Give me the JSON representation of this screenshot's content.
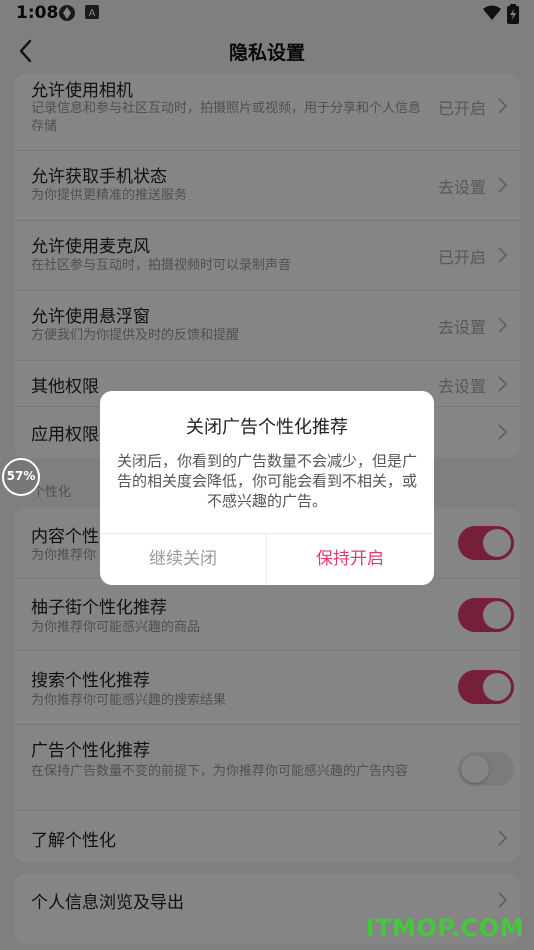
{
  "status": {
    "time": "1:08"
  },
  "header": {
    "title": "隐私设置"
  },
  "permissions": [
    {
      "title": "允许使用相机",
      "subtitle": "记录信息和参与社区互动时，拍摄照片或视频，用于分享和个人信息存储",
      "value": "已开启"
    },
    {
      "title": "允许获取手机状态",
      "subtitle": "为你提供更精准的推送服务",
      "value": "去设置"
    },
    {
      "title": "允许使用麦克风",
      "subtitle": "在社区参与互动时，拍摄视频时可以录制声音",
      "value": "已开启"
    },
    {
      "title": "允许使用悬浮窗",
      "subtitle": "方便我们为你提供及时的反馈和提醒",
      "value": "去设置"
    },
    {
      "title": "其他权限",
      "subtitle": "",
      "value": "去设置"
    },
    {
      "title": "应用权限",
      "subtitle": "",
      "value": ""
    }
  ],
  "section_title": "个性化",
  "personalization": [
    {
      "title": "内容个性",
      "subtitle": "为你推荐你",
      "on": true
    },
    {
      "title": "柚子街个性化推荐",
      "subtitle": "为你推荐你可能感兴趣的商品",
      "on": true
    },
    {
      "title": "搜索个性化推荐",
      "subtitle": "为你推荐你可能感兴趣的搜索结果",
      "on": true
    },
    {
      "title": "广告个性化推荐",
      "subtitle": "在保持广告数量不变的前提下，为你推荐你可能感兴趣的广告内容",
      "on": false
    },
    {
      "title": "了解个性化",
      "subtitle": ""
    }
  ],
  "export_row": {
    "title": "个人信息浏览及导出"
  },
  "badge": {
    "text": "57%"
  },
  "dialog": {
    "title": "关闭广告个性化推荐",
    "body": "关闭后，你看到的广告数量不会减少，但是广告的相关度会降低，你可能会看到不相关，或不感兴趣的广告。",
    "cancel": "继续关闭",
    "confirm": "保持开启"
  },
  "watermark": "ITMOP.COM",
  "colors": {
    "accent": "#e23c6e",
    "toggle_off": "#ececec"
  }
}
